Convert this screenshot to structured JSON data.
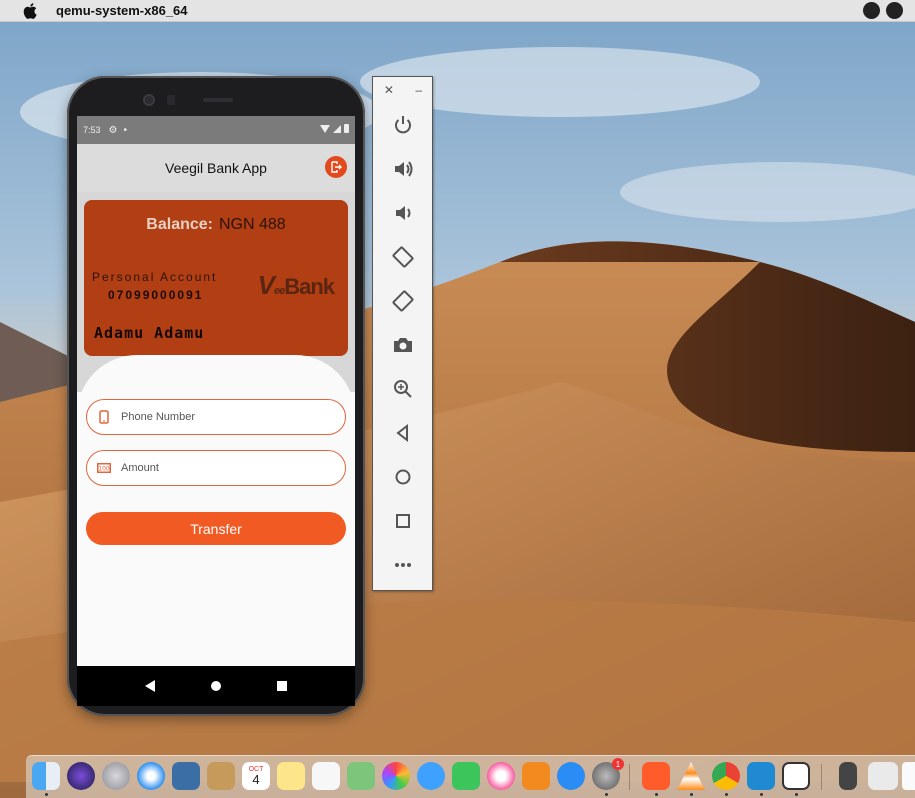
{
  "menubar": {
    "app_name": "qemu-system-x86_64"
  },
  "phone": {
    "status": {
      "time": "7:53"
    },
    "appbar": {
      "title": "Veegil Bank App"
    },
    "card": {
      "balance_label": "Balance:",
      "balance_value": "NGN 488",
      "account_type": "Personal Account",
      "account_number": "07099000091",
      "logo_v": "V",
      "logo_ee": "ee",
      "logo_bank": "Bank",
      "holder_name": "Adamu Adamu"
    },
    "form": {
      "phone_placeholder": "Phone Number",
      "amount_placeholder": "Amount",
      "transfer_label": "Transfer"
    }
  },
  "emulator": {
    "close_label": "✕",
    "minimize_label": "–",
    "buttons": [
      "power-icon",
      "volume-up-icon",
      "volume-down-icon",
      "rotate-left-icon",
      "rotate-right-icon",
      "camera-icon",
      "zoom-icon",
      "back-icon",
      "home-icon",
      "overview-icon",
      "more-icon"
    ]
  },
  "dock": {
    "calendar_month": "OCT",
    "calendar_day": "4",
    "sysprefs_badge": "1"
  },
  "colors": {
    "accent": "#f25a24",
    "card": "#b23f13",
    "field_border": "#e4643c"
  }
}
